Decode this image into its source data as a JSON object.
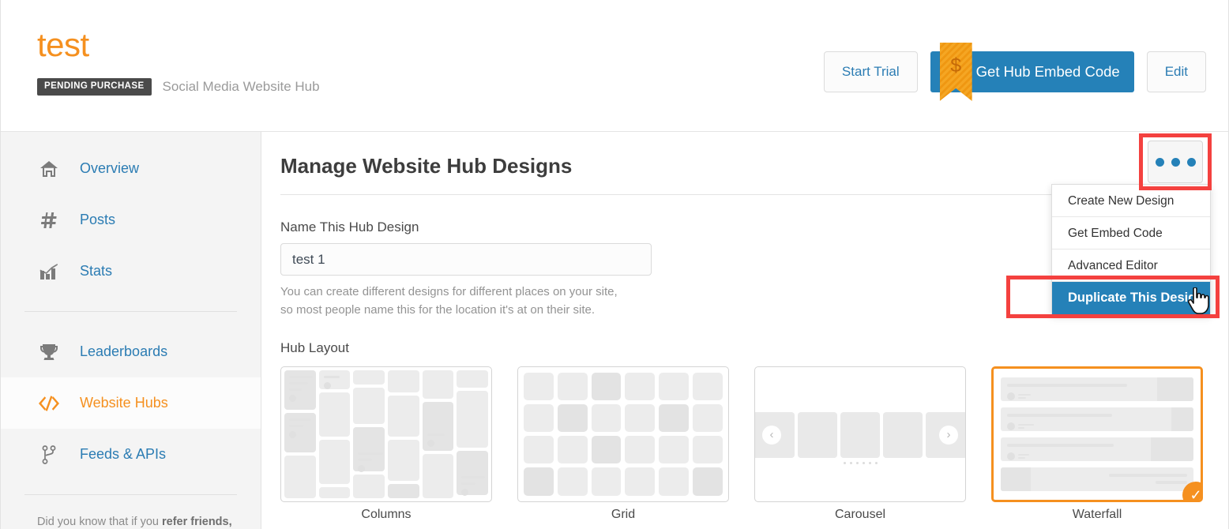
{
  "header": {
    "title": "test",
    "status_badge": "PENDING PURCHASE",
    "subtitle": "Social Media Website Hub",
    "buttons": {
      "start_trial": "Start Trial",
      "get_hub_embed_code": "Get Hub Embed Code",
      "edit": "Edit",
      "ribbon_symbol": "$"
    }
  },
  "sidebar": {
    "items": [
      {
        "label": "Overview",
        "icon": "home-icon",
        "active": false
      },
      {
        "label": "Posts",
        "icon": "hashtag-icon",
        "active": false
      },
      {
        "label": "Stats",
        "icon": "bar-chart-icon",
        "active": false
      },
      {
        "label": "Leaderboards",
        "icon": "trophy-icon",
        "active": false
      },
      {
        "label": "Website Hubs",
        "icon": "code-icon",
        "active": true
      },
      {
        "label": "Feeds & APIs",
        "icon": "code-fork-icon",
        "active": false
      }
    ],
    "note_prefix": "Did you know that if you ",
    "note_link": "refer friends,"
  },
  "main": {
    "page_title": "Manage Website Hub Designs",
    "name_field": {
      "label": "Name This Hub Design",
      "value": "test 1",
      "placeholder": "Name This Hub Design",
      "help_line1": "You can create different designs for different places on your site,",
      "help_line2": "so most people name this for the location it's at on their site."
    },
    "hub_layout": {
      "label": "Hub Layout",
      "options": [
        {
          "label": "Columns",
          "selected": false
        },
        {
          "label": "Grid",
          "selected": false
        },
        {
          "label": "Carousel",
          "selected": false
        },
        {
          "label": "Waterfall",
          "selected": true
        }
      ],
      "selected_check": "✓"
    }
  },
  "dropdown": {
    "trigger_icon": "kebab-menu-icon",
    "items": [
      {
        "label": "Create New Design",
        "highlighted": false
      },
      {
        "label": "Get Embed Code",
        "highlighted": false
      },
      {
        "label": "Advanced Editor",
        "highlighted": false
      },
      {
        "label": "Duplicate This Design",
        "highlighted": true
      }
    ]
  },
  "colors": {
    "brand_orange": "#f5901f",
    "link_blue": "#2b7cb3",
    "primary_blue": "#2581b8",
    "annotation_red": "#f4413f",
    "badge_dark": "#4a4a4a"
  }
}
